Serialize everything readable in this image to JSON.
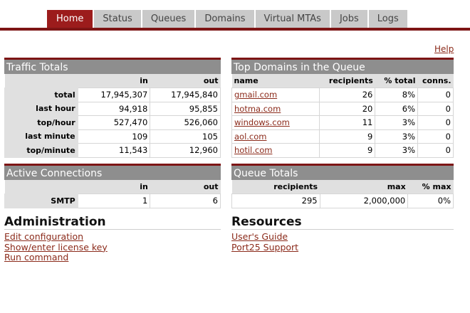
{
  "nav": {
    "tabs": [
      {
        "label": "Home"
      },
      {
        "label": "Status"
      },
      {
        "label": "Queues"
      },
      {
        "label": "Domains"
      },
      {
        "label": "Virtual MTAs"
      },
      {
        "label": "Jobs"
      },
      {
        "label": "Logs"
      }
    ],
    "active_index": 0
  },
  "help_link": "Help",
  "traffic": {
    "title": "Traffic Totals",
    "headers": [
      "",
      "in",
      "out"
    ],
    "rows": [
      {
        "label": "total",
        "in": "17,945,307",
        "out": "17,945,840"
      },
      {
        "label": "last hour",
        "in": "94,918",
        "out": "95,855"
      },
      {
        "label": "top/hour",
        "in": "527,470",
        "out": "526,060"
      },
      {
        "label": "last minute",
        "in": "109",
        "out": "105"
      },
      {
        "label": "top/minute",
        "in": "11,543",
        "out": "12,960"
      }
    ]
  },
  "top_domains": {
    "title": "Top Domains in the Queue",
    "headers": [
      "name",
      "recipients",
      "% total",
      "conns."
    ],
    "rows": [
      {
        "name": "gmail.com",
        "recipients": "26",
        "pct": "8%",
        "conns": "0"
      },
      {
        "name": "hotma.com",
        "recipients": "20",
        "pct": "6%",
        "conns": "0"
      },
      {
        "name": "windows.com",
        "recipients": "11",
        "pct": "3%",
        "conns": "0"
      },
      {
        "name": "aol.com",
        "recipients": "9",
        "pct": "3%",
        "conns": "0"
      },
      {
        "name": "hotil.com",
        "recipients": "9",
        "pct": "3%",
        "conns": "0"
      }
    ]
  },
  "active_connections": {
    "title": "Active Connections",
    "headers": [
      "",
      "in",
      "out"
    ],
    "rows": [
      {
        "label": "SMTP",
        "in": "1",
        "out": "6"
      }
    ]
  },
  "queue_totals": {
    "title": "Queue Totals",
    "headers": [
      "recipients",
      "max",
      "% max"
    ],
    "values": {
      "recipients": "295",
      "max": "2,000,000",
      "pct_max": "0%"
    }
  },
  "administration": {
    "title": "Administration",
    "links": [
      "Edit configuration",
      "Show/enter license key",
      "Run command"
    ]
  },
  "resources": {
    "title": "Resources",
    "links": [
      "User's Guide",
      "Port25 Support"
    ]
  }
}
